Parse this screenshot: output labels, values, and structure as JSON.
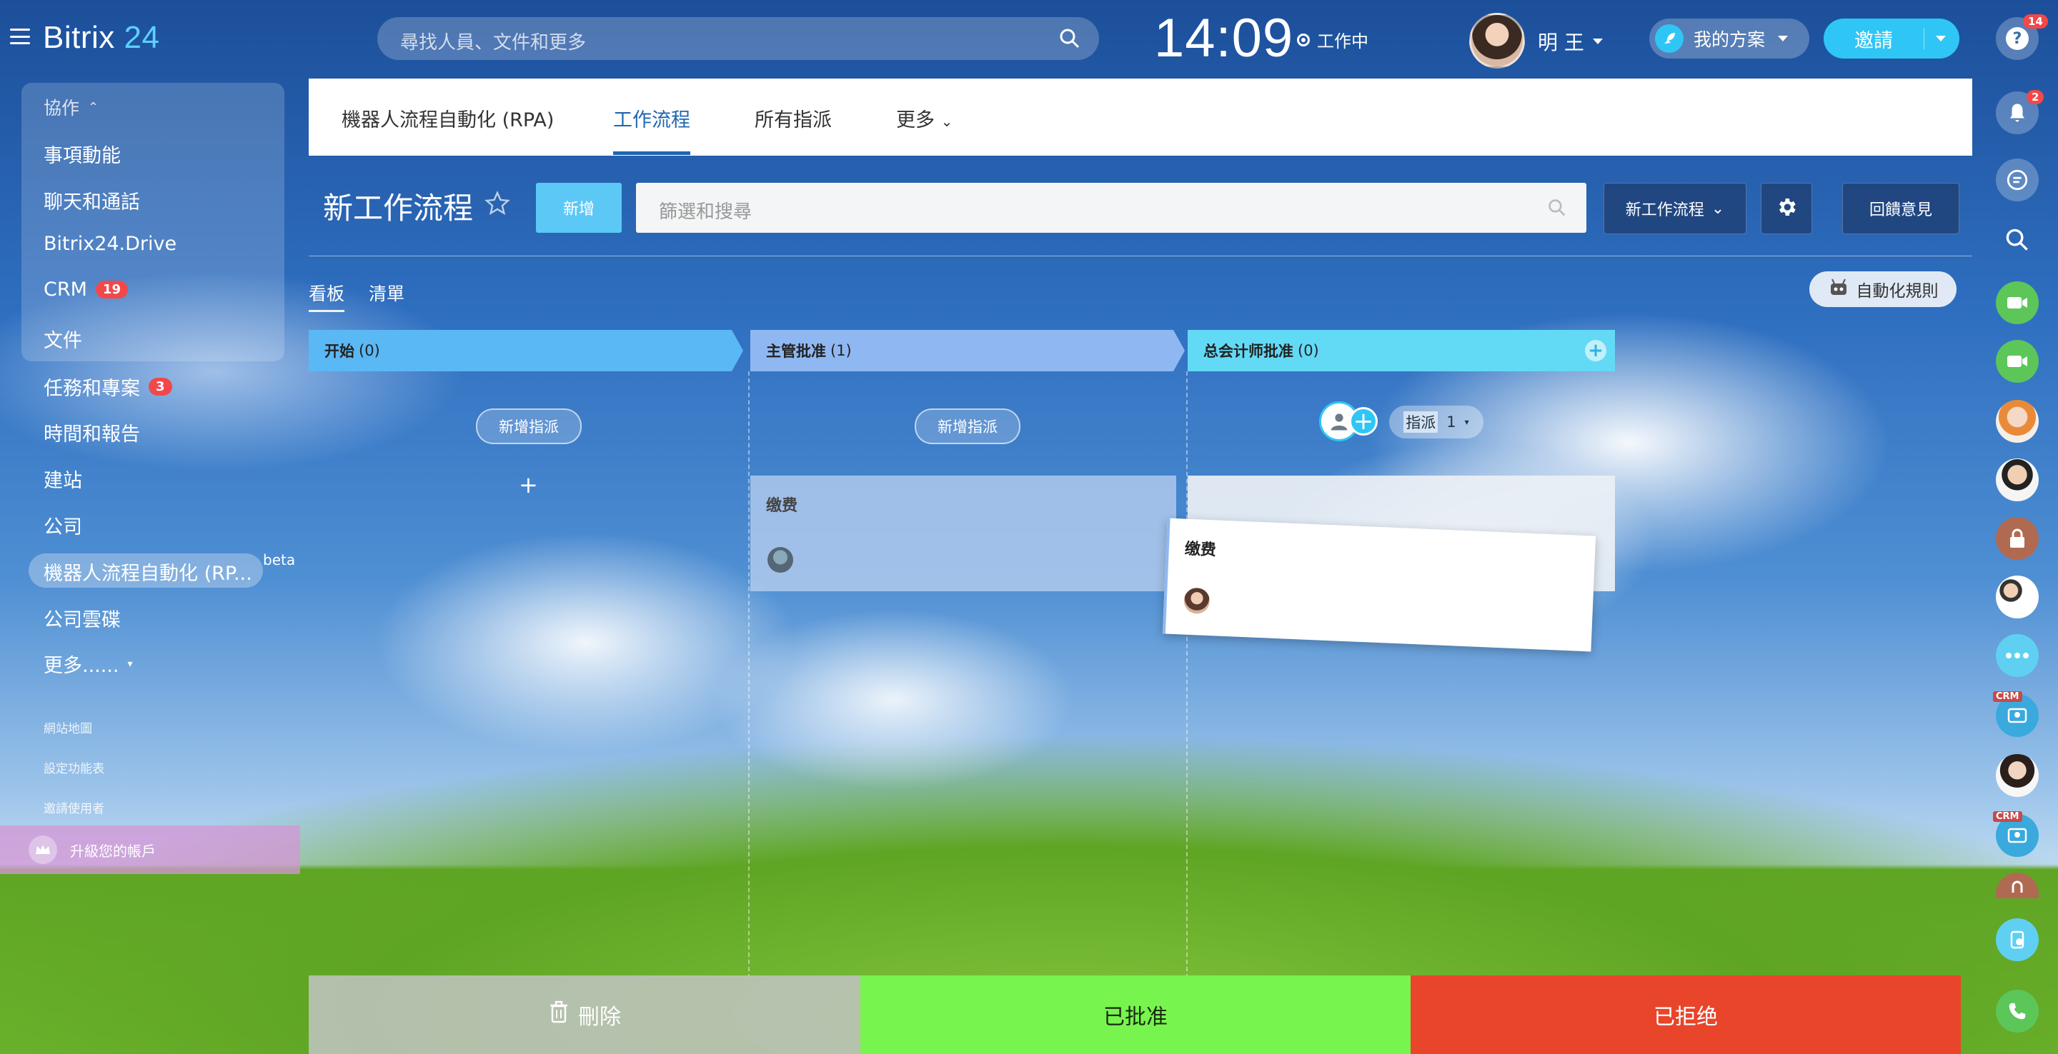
{
  "header": {
    "logo_text": "Bitrix",
    "logo_num": "24",
    "search_placeholder": "尋找人員、文件和更多",
    "time": "14:09",
    "status": "工作中",
    "user_name": "明 王",
    "plan_label": "我的方案",
    "invite_label": "邀請"
  },
  "sidebar": {
    "group_label": "協作",
    "items": [
      {
        "label": "事項動能"
      },
      {
        "label": "聊天和通話"
      },
      {
        "label": "Bitrix24.Drive"
      },
      {
        "label": "CRM",
        "badge": "19"
      },
      {
        "label": "文件"
      },
      {
        "label": "任務和專案",
        "badge": "3"
      },
      {
        "label": "時間和報告"
      },
      {
        "label": "建站"
      },
      {
        "label": "公司"
      },
      {
        "label": "機器人流程自動化 (RP..."
      },
      {
        "label": "公司雲碟"
      },
      {
        "label": "更多......"
      }
    ],
    "beta": "beta",
    "links": [
      "網站地圖",
      "設定功能表",
      "邀請使用者"
    ],
    "upgrade": "升級您的帳戶"
  },
  "tabs": {
    "items": [
      "機器人流程自動化 (RPA)",
      "工作流程",
      "所有指派",
      "更多"
    ],
    "active": "工作流程"
  },
  "toolbar": {
    "title": "新工作流程",
    "new_button": "新增",
    "filter_placeholder": "篩選和搜尋",
    "workflow_button": "新工作流程",
    "feedback_button": "回饋意見"
  },
  "views": {
    "kanban": "看板",
    "list": "清單",
    "automation_rules": "自動化規則"
  },
  "columns": [
    {
      "name": "开始",
      "count": "(0)",
      "add_task": "新增指派",
      "color": "#5ab8f5"
    },
    {
      "name": "主管批准",
      "count": "(1)",
      "add_task": "新增指派",
      "color": "#8fb8f2"
    },
    {
      "name": "总会计师批准",
      "count": "(0)",
      "assign_label": "指派",
      "assign_count": "1",
      "color": "#63daf5"
    }
  ],
  "cards": {
    "card1_title": "缴费",
    "card2_title": "缴费"
  },
  "actions": {
    "delete": "刪除",
    "approved": "已批准",
    "rejected": "已拒绝"
  },
  "rail": {
    "help_badge": "14",
    "notify_badge": "2",
    "crm_tag": "CRM"
  }
}
